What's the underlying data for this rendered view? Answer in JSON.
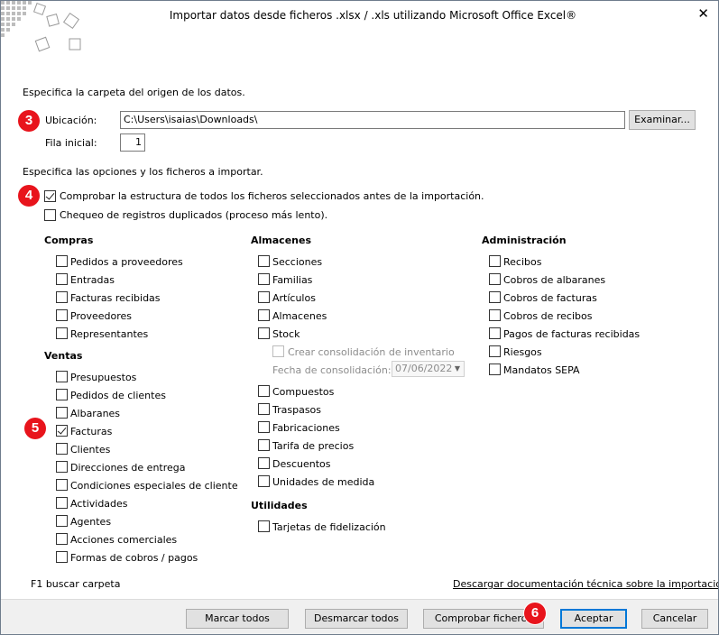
{
  "window": {
    "title": "Importar datos desde ficheros .xlsx / .xls utilizando Microsoft Office Excel®",
    "close_glyph": "✕"
  },
  "source": {
    "heading": "Especifica la carpeta del origen de los datos.",
    "location_label": "Ubicación:",
    "location_value": "C:\\Users\\isaias\\Downloads\\",
    "browse_button": "Examinar...",
    "start_row_label": "Fila inicial:",
    "start_row_value": "1"
  },
  "options": {
    "heading": "Especifica las opciones y los ficheros a importar.",
    "check_structure": "Comprobar la estructura de todos los ficheros seleccionados antes de la importación.",
    "check_duplicates": "Chequeo de registros duplicados (proceso más lento)."
  },
  "groups": {
    "compras": {
      "title": "Compras",
      "items": [
        "Pedidos a proveedores",
        "Entradas",
        "Facturas recibidas",
        "Proveedores",
        "Representantes"
      ]
    },
    "ventas": {
      "title": "Ventas",
      "items": [
        "Presupuestos",
        "Pedidos de clientes",
        "Albaranes",
        "Facturas",
        "Clientes",
        "Direcciones de entrega",
        "Condiciones especiales de cliente",
        "Actividades",
        "Agentes",
        "Acciones comerciales",
        "Formas de cobros / pagos"
      ]
    },
    "almacenes": {
      "title": "Almacenes",
      "items": [
        "Secciones",
        "Familias",
        "Artículos",
        "Almacenes",
        "Stock"
      ],
      "consolidation_label": "Crear consolidación de inventario",
      "consolidation_date_label": "Fecha de consolidación:",
      "consolidation_date_value": "07/06/2022",
      "items_after": [
        "Compuestos",
        "Traspasos",
        "Fabricaciones",
        "Tarifa de precios",
        "Descuentos",
        "Unidades de medida"
      ]
    },
    "utilidades": {
      "title": "Utilidades",
      "items": [
        "Tarjetas de fidelización"
      ]
    },
    "administracion": {
      "title": "Administración",
      "items": [
        "Recibos",
        "Cobros de albaranes",
        "Cobros de facturas",
        "Cobros de recibos",
        "Pagos de facturas recibidas",
        "Riesgos",
        "Mandatos SEPA"
      ]
    }
  },
  "hints": {
    "f1": "F1 buscar carpeta",
    "doc_link": "Descargar documentación técnica sobre la importación"
  },
  "buttons": {
    "mark_all": "Marcar todos",
    "unmark_all": "Desmarcar todos",
    "check_files": "Comprobar ficheros",
    "accept": "Aceptar",
    "cancel": "Cancelar"
  },
  "steps": [
    "3",
    "4",
    "5",
    "6"
  ],
  "colors": {
    "step_badge": "#e8141c",
    "accent_border": "#0078d7"
  }
}
